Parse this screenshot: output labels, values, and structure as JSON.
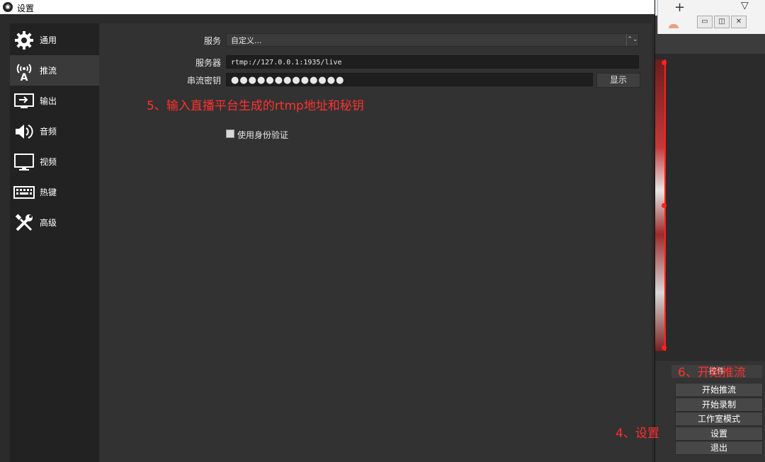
{
  "dialog": {
    "title": "设置",
    "nav": [
      {
        "label": "通用",
        "icon": "gear-icon",
        "active": false
      },
      {
        "label": "推流",
        "icon": "broadcast-antenna-icon",
        "active": true
      },
      {
        "label": "输出",
        "icon": "output-monitor-icon",
        "active": false
      },
      {
        "label": "音频",
        "icon": "speaker-icon",
        "active": false
      },
      {
        "label": "视频",
        "icon": "monitor-icon",
        "active": false
      },
      {
        "label": "热键",
        "icon": "keyboard-icon",
        "active": false
      },
      {
        "label": "高级",
        "icon": "tools-icon",
        "active": false
      }
    ],
    "stream": {
      "service_label": "服务",
      "service_value": "自定义...",
      "server_label": "服务器",
      "server_value": "rtmp://127.0.0.1:1935/live",
      "key_label": "串流密钥",
      "key_value": "●●●●●●●●●●●●●",
      "show_button": "显示",
      "auth_label": "使用身份验证",
      "auth_checked": false
    }
  },
  "main_window": {
    "controls_header": "控件",
    "buttons": {
      "start_stream": "开始推流",
      "start_record": "开始录制",
      "studio_mode": "工作室模式",
      "settings": "设置",
      "exit": "退出"
    }
  },
  "annotations": {
    "step5": "5、输入直播平台生成的rtmp地址和秘钥",
    "step6": "6、开始推流",
    "step4": "4、设置"
  },
  "colors": {
    "annotation": "#ff3030",
    "dialog_bg": "#2b2b2b",
    "content_bg": "#323232"
  }
}
